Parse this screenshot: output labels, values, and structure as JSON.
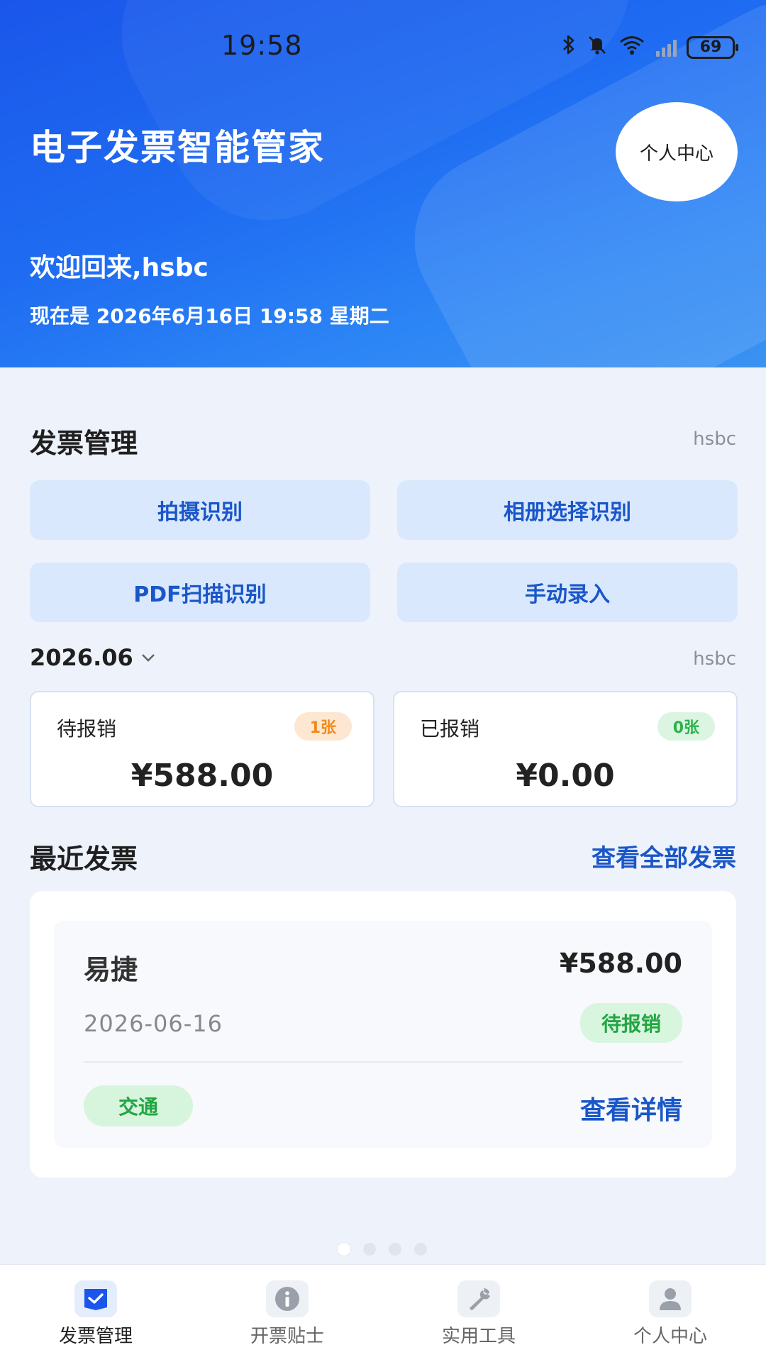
{
  "status_bar": {
    "time": "19:58",
    "battery": "69",
    "icons": [
      "bluetooth-icon",
      "mute-bell-icon",
      "wifi-icon",
      "cellular-signal-icon",
      "battery-icon"
    ]
  },
  "header": {
    "title": "电子发票智能管家",
    "profile_button": "个人中心",
    "welcome": "欢迎回来,hsbc",
    "now": "现在是 2026年6月16日 19:58 星期二"
  },
  "invoice_management": {
    "title": "发票管理",
    "user": "hsbc",
    "actions": [
      {
        "label": "拍摄识别"
      },
      {
        "label": "相册选择识别"
      },
      {
        "label": "PDF扫描识别"
      },
      {
        "label": "手动录入"
      }
    ]
  },
  "summary": {
    "month": "2026.06",
    "user": "hsbc",
    "pending": {
      "label": "待报销",
      "count": "1张",
      "amount": "¥588.00"
    },
    "done": {
      "label": "已报销",
      "count": "0张",
      "amount": "¥0.00"
    }
  },
  "recent": {
    "title": "最近发票",
    "view_all": "查看全部发票",
    "invoices": [
      {
        "name": "易捷",
        "amount": "¥588.00",
        "date": "2026-06-16",
        "status": "待报销",
        "category": "交通",
        "detail": "查看详情"
      }
    ]
  },
  "pager": {
    "total": 4,
    "active": 0
  },
  "bottom_nav": [
    {
      "label": "发票管理",
      "icon": "invoice-check-icon",
      "active": true
    },
    {
      "label": "开票贴士",
      "icon": "info-icon",
      "active": false
    },
    {
      "label": "实用工具",
      "icon": "wrench-icon",
      "active": false
    },
    {
      "label": "个人中心",
      "icon": "person-icon",
      "active": false
    }
  ],
  "colors": {
    "header_blue": "#1f6df2",
    "accent_blue": "#1a56c8",
    "button_bg": "#d9e8fc",
    "pending_orange": "#f08a1c",
    "status_green": "#22a542"
  }
}
